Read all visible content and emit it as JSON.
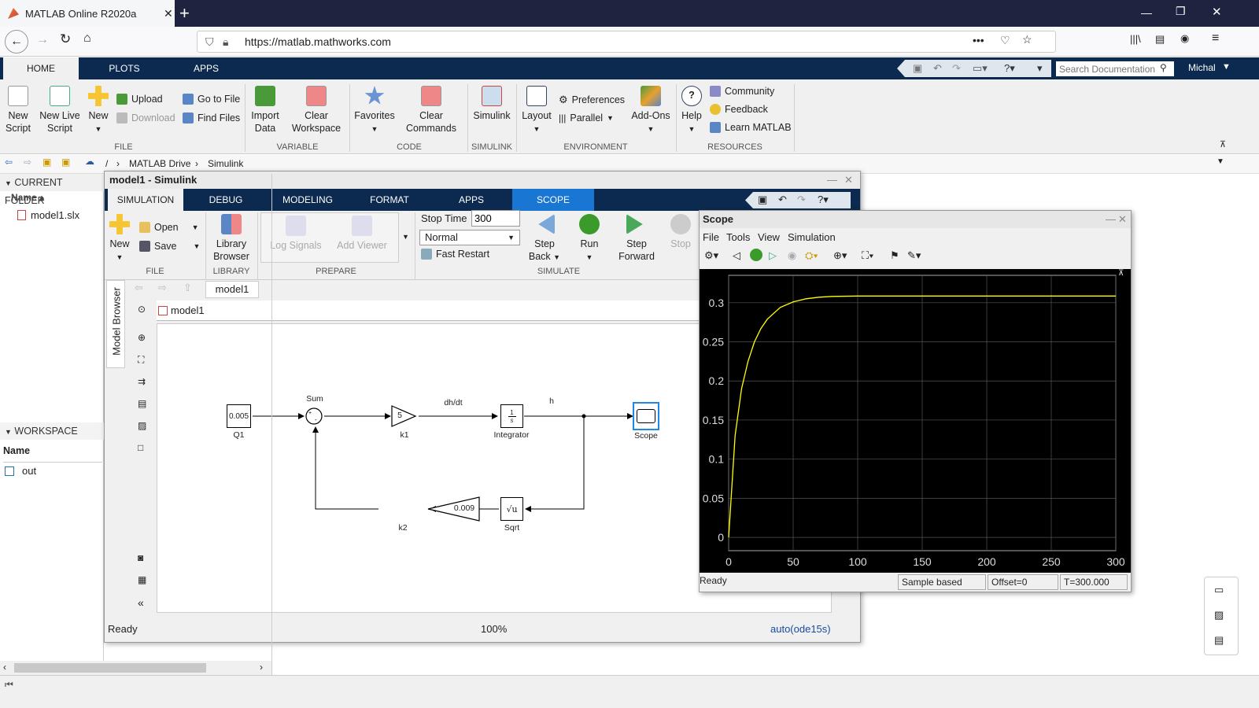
{
  "browser": {
    "tab_title": "MATLAB Online R2020a",
    "url": "https://matlab.mathworks.com",
    "close": "✕",
    "new_tab": "+"
  },
  "matlab": {
    "tabs": [
      "HOME",
      "PLOTS",
      "APPS"
    ],
    "search_placeholder": "Search Documentation",
    "user": "Michal",
    "file": {
      "new_script": "New Script",
      "new_live_script": "New Live Script",
      "new": "New",
      "upload": "Upload",
      "download": "Download",
      "go_to_file": "Go to File",
      "find_files": "Find Files",
      "section": "FILE"
    },
    "variable": {
      "import_data": "Import Data",
      "clear_workspace": "Clear Workspace",
      "section": "VARIABLE"
    },
    "code": {
      "favorites": "Favorites",
      "clear_commands": "Clear Commands",
      "section": "CODE"
    },
    "simulink": {
      "simulink": "Simulink",
      "section": "SIMULINK"
    },
    "environment": {
      "layout": "Layout",
      "preferences": "Preferences",
      "parallel": "Parallel",
      "addons": "Add-Ons",
      "section": "ENVIRONMENT"
    },
    "resources": {
      "help": "Help",
      "community": "Community",
      "feedback": "Feedback",
      "learn": "Learn MATLAB",
      "section": "RESOURCES"
    },
    "path": [
      "/",
      "MATLAB Drive",
      "Simulink"
    ],
    "current_folder": {
      "title": "CURRENT FOLDER",
      "col": "Name ▴",
      "files": [
        "model1.slx"
      ]
    },
    "workspace": {
      "title": "WORKSPACE",
      "col": "Name",
      "vars": [
        "out"
      ]
    }
  },
  "simulink": {
    "title": "model1 - Simulink",
    "tabs": [
      "SIMULATION",
      "DEBUG",
      "MODELING",
      "FORMAT",
      "APPS",
      "SCOPE"
    ],
    "ribbon": {
      "new": "New",
      "open": "Open",
      "save": "Save",
      "file_section": "FILE",
      "library_browser": "Library Browser",
      "library_section": "LIBRARY",
      "log_signals": "Log Signals",
      "add_viewer": "Add Viewer",
      "prepare_section": "PREPARE",
      "stop_time_label": "Stop Time",
      "stop_time": "300",
      "mode": "Normal",
      "fast_restart": "Fast Restart",
      "step_back": "Step Back",
      "run": "Run",
      "step_forward": "Step Forward",
      "stop": "Stop",
      "simulate_section": "SIMULATE"
    },
    "model_browser": "Model Browser",
    "model_tab": "model1",
    "model_path": "model1",
    "blocks": {
      "q1_value": "0.005",
      "q1_label": "Q1",
      "sum_label": "Sum",
      "k1_value": "5",
      "k1_label": "k1",
      "integrator_label": "Integrator",
      "scope_label": "Scope",
      "sqrt_label": "Sqrt",
      "k2_value": "0.009",
      "k2_label": "k2",
      "signal_dhdt": "dh/dt",
      "signal_h": "h"
    },
    "status": {
      "ready": "Ready",
      "zoom": "100%",
      "solver": "auto(ode15s)"
    }
  },
  "scope": {
    "title": "Scope",
    "menu": [
      "File",
      "Tools",
      "View",
      "Simulation"
    ],
    "status": {
      "ready": "Ready",
      "mode": "Sample based",
      "offset": "Offset=0",
      "time": "T=300.000"
    }
  },
  "chart_data": {
    "type": "line",
    "title": "",
    "xlabel": "",
    "ylabel": "",
    "xlim": [
      0,
      300
    ],
    "ylim": [
      -0.017,
      0.335
    ],
    "xticks": [
      0,
      50,
      100,
      150,
      200,
      250,
      300
    ],
    "yticks": [
      0,
      0.05,
      0.1,
      0.15,
      0.2,
      0.25,
      0.3
    ],
    "ytick_labels": [
      "0",
      "0.05",
      "0.1",
      "0.15",
      "0.2",
      "0.25",
      "0.3"
    ],
    "grid": true,
    "background": "#000000",
    "series": [
      {
        "color": "#ffff00",
        "x": [
          0,
          5,
          10,
          15,
          20,
          25,
          30,
          40,
          50,
          60,
          70,
          80,
          100,
          120,
          150,
          200,
          250,
          300
        ],
        "y": [
          0,
          0.13,
          0.19,
          0.225,
          0.25,
          0.267,
          0.279,
          0.294,
          0.301,
          0.305,
          0.307,
          0.308,
          0.3086,
          0.3086,
          0.3086,
          0.3086,
          0.3086,
          0.3086
        ]
      }
    ]
  },
  "colors": {
    "matlab_bar": "#0c2a4f",
    "scope_tab": "#1976d2",
    "browser_bar": "#202340"
  }
}
